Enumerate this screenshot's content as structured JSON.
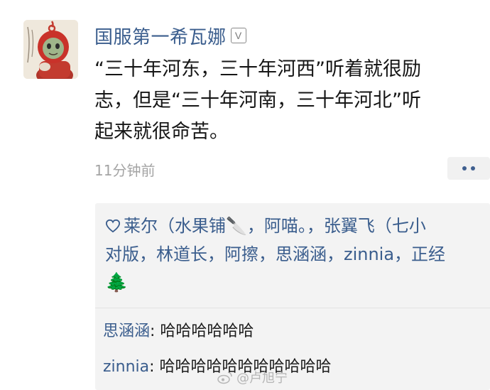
{
  "post": {
    "author": "国服第一希瓦娜",
    "badge": "V",
    "lines": [
      "“三十年河东，三十年河西”听着就很励",
      "志，但是“三十年河南，三十年河北”听",
      "起来就很命苦。"
    ],
    "time": "11分钟前"
  },
  "likes": {
    "line1": "莱尔（水果铺🔪，阿喵。，张翼飞（七小",
    "line2": "对版，林道长，阿擦，思涵涵，zinnia，正经",
    "line3": "🌲"
  },
  "comments": [
    {
      "name": "思涵涵",
      "text": ": 哈哈哈哈哈哈"
    },
    {
      "name": "zinnia",
      "text": ": 哈哈哈哈哈哈哈哈哈哈哈"
    }
  ],
  "watermark": "@卢旭宁",
  "icons": {
    "avatar": "teletubby-avatar-icon",
    "like": "heart-outline-icon",
    "more": "more-dots-icon"
  },
  "colors": {
    "link": "#3a5d8d",
    "panel": "#f3f3f3",
    "time": "#a4a4a4"
  }
}
